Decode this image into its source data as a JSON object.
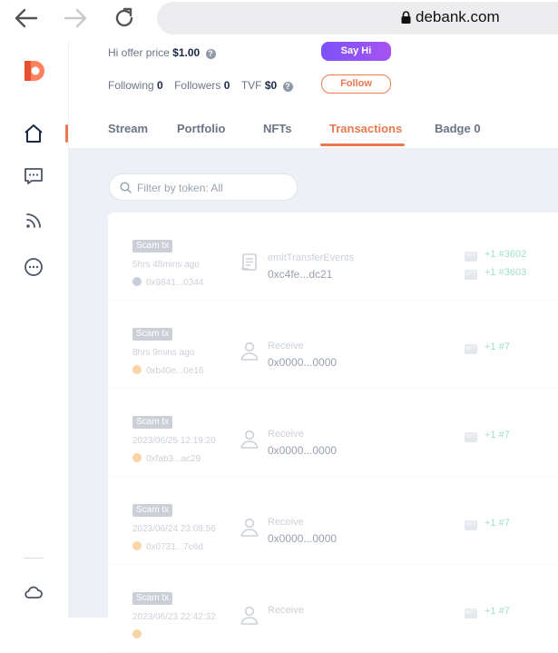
{
  "browser": {
    "url": "debank.com"
  },
  "profile": {
    "offer_label": "Hi offer price",
    "offer_value": "$1.00",
    "say_hi": "Say Hi",
    "following_label": "Following",
    "following_count": "0",
    "followers_label": "Followers",
    "followers_count": "0",
    "tvf_label": "TVF",
    "tvf_value": "$0",
    "follow": "Follow"
  },
  "tabs": [
    {
      "label": "Stream"
    },
    {
      "label": "Portfolio"
    },
    {
      "label": "NFTs"
    },
    {
      "label": "Transactions",
      "active": true
    },
    {
      "label": "Badge 0"
    }
  ],
  "filter": {
    "placeholder": "Filter by token: All"
  },
  "transactions": [
    {
      "badge": "Scam tx",
      "time": "5hrs 48mins ago",
      "chain_icon": "eth-icon",
      "chain_color": "#8a92b2",
      "from": "0x9841...0344",
      "type": "emitTransferEvents",
      "type_icon": "contract-icon",
      "addr": "0xc4fe...dc21",
      "tokens": [
        "+1 #3602",
        "+1 #3603"
      ]
    },
    {
      "badge": "Scam tx",
      "time": "8hrs 9mins ago",
      "chain_icon": "arbitrum-icon",
      "chain_color": "#f0a23b",
      "from": "0xb40e...0e16",
      "type": "Receive",
      "type_icon": "user-icon",
      "addr": "0x0000...0000",
      "tokens": [
        "+1 #7"
      ]
    },
    {
      "badge": "Scam tx",
      "time": "2023/06/25 12:19:20",
      "chain_icon": "arbitrum-icon",
      "chain_color": "#f0a23b",
      "from": "0xfab3...ac29",
      "type": "Receive",
      "type_icon": "user-icon",
      "addr": "0x0000...0000",
      "tokens": [
        "+1 #7"
      ]
    },
    {
      "badge": "Scam tx",
      "time": "2023/06/24 23:08:56",
      "chain_icon": "arbitrum-icon",
      "chain_color": "#f0a23b",
      "from": "0x0731...7c6d",
      "type": "Receive",
      "type_icon": "user-icon",
      "addr": "0x0000...0000",
      "tokens": [
        "+1 #7"
      ]
    },
    {
      "badge": "Scam tx",
      "time": "2023/06/23 22:42:32",
      "chain_icon": "arbitrum-icon",
      "chain_color": "#f0a23b",
      "from": "",
      "type": "Receive",
      "type_icon": "user-icon",
      "addr": "",
      "tokens": [
        "+1 #7"
      ]
    }
  ],
  "colors": {
    "accent": "#ea7952",
    "scam_badge": "#8e98a8",
    "token_green": "#2abb7f",
    "say_hi": "#8b53f5"
  },
  "nft_badge_text": "NFT"
}
